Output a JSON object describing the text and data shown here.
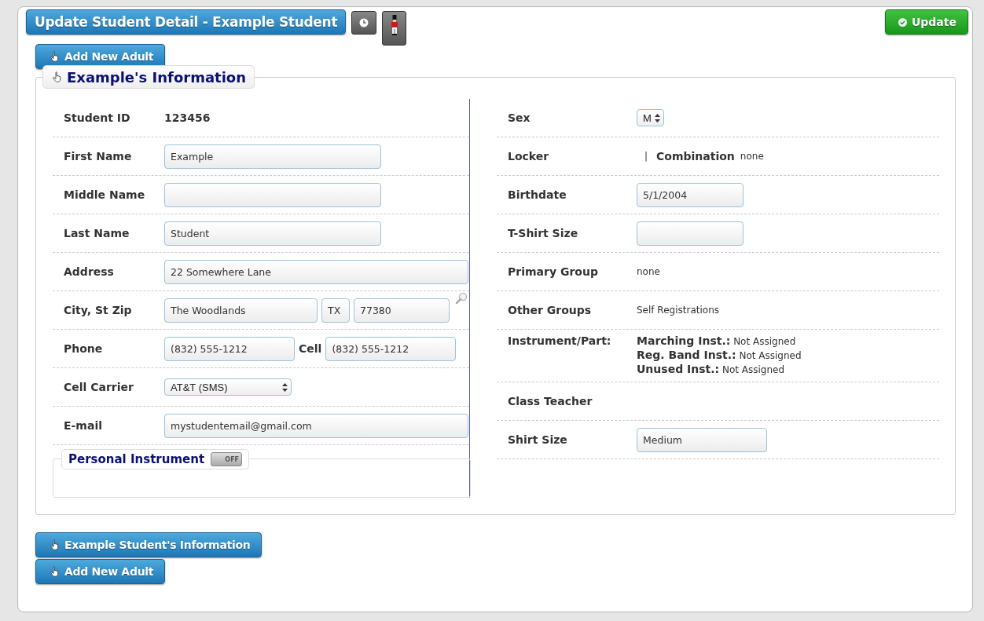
{
  "header": {
    "title": "Update Student Detail - Example Student",
    "tools": [
      {
        "kind": "clock"
      },
      {
        "kind": "soldier"
      }
    ]
  },
  "update_button": "Update",
  "add_adult_top": "Add New Adult",
  "section": {
    "legend": "Example's Information",
    "left_rows": [
      {
        "label": "Student ID",
        "items": [
          {
            "kind": "strong",
            "value": "123456"
          }
        ]
      },
      {
        "label": "First Name",
        "items": [
          {
            "kind": "input",
            "value": "Example"
          }
        ]
      },
      {
        "label": "Middle Name",
        "items": [
          {
            "kind": "input"
          }
        ]
      },
      {
        "label": "Last Name",
        "items": [
          {
            "kind": "input",
            "value": "Student"
          }
        ]
      },
      {
        "label": "Address",
        "items": [
          {
            "kind": "input",
            "value": "22 Somewhere Lane"
          }
        ]
      },
      {
        "label": "City, St Zip",
        "items": [
          {
            "kind": "input",
            "value": "The Woodlands"
          },
          {
            "kind": "input",
            "value": "TX"
          },
          {
            "kind": "input",
            "value": "77380"
          },
          {
            "kind": "search"
          }
        ]
      },
      {
        "label": "Phone",
        "items": [
          {
            "kind": "input",
            "value": "(832) 555-1212"
          },
          {
            "kind": "label",
            "value": "Cell"
          },
          {
            "kind": "input",
            "value": "(832) 555-1212"
          }
        ]
      },
      {
        "label": "Cell Carrier",
        "items": [
          {
            "kind": "select",
            "value": "AT&T (SMS)"
          }
        ]
      },
      {
        "label": "E-mail",
        "items": [
          {
            "kind": "input",
            "value": "mystudentemail@gmail.com"
          }
        ]
      }
    ],
    "personal_instrument": {
      "label": "Personal Instrument",
      "on": false,
      "toggle_text": "OFF"
    },
    "right_rows": [
      {
        "label": "Sex",
        "items": [
          {
            "kind": "select",
            "value": "M"
          }
        ]
      },
      {
        "label": "Locker",
        "items": [
          {
            "kind": "text",
            "value": "|"
          },
          {
            "kind": "label",
            "value": "Combination"
          },
          {
            "kind": "text",
            "value": "none"
          }
        ]
      },
      {
        "label": "Birthdate",
        "items": [
          {
            "kind": "input",
            "value": "5/1/2004"
          }
        ]
      },
      {
        "label": "T-Shirt Size",
        "items": [
          {
            "kind": "input"
          }
        ]
      },
      {
        "label": "Primary Group",
        "items": [
          {
            "kind": "text",
            "value": "none"
          }
        ]
      },
      {
        "label": "Other Groups",
        "items": [
          {
            "kind": "text",
            "value": "Self Registrations"
          }
        ]
      },
      {
        "label": "Instrument/Part:",
        "items": [
          {
            "kind": "assignments",
            "lines": [
              {
                "label": "Marching Inst.:",
                "value": "Not Assigned"
              },
              {
                "label": "Reg. Band Inst.:",
                "value": "Not Assigned"
              },
              {
                "label": "Unused Inst.:",
                "value": "Not Assigned"
              }
            ]
          }
        ]
      },
      {
        "label": "Class Teacher"
      },
      {
        "label": "Shirt Size",
        "items": [
          {
            "kind": "input",
            "value": "Medium"
          }
        ]
      }
    ]
  },
  "bottom_buttons": [
    "Example Student's Information",
    "Add New Adult"
  ]
}
